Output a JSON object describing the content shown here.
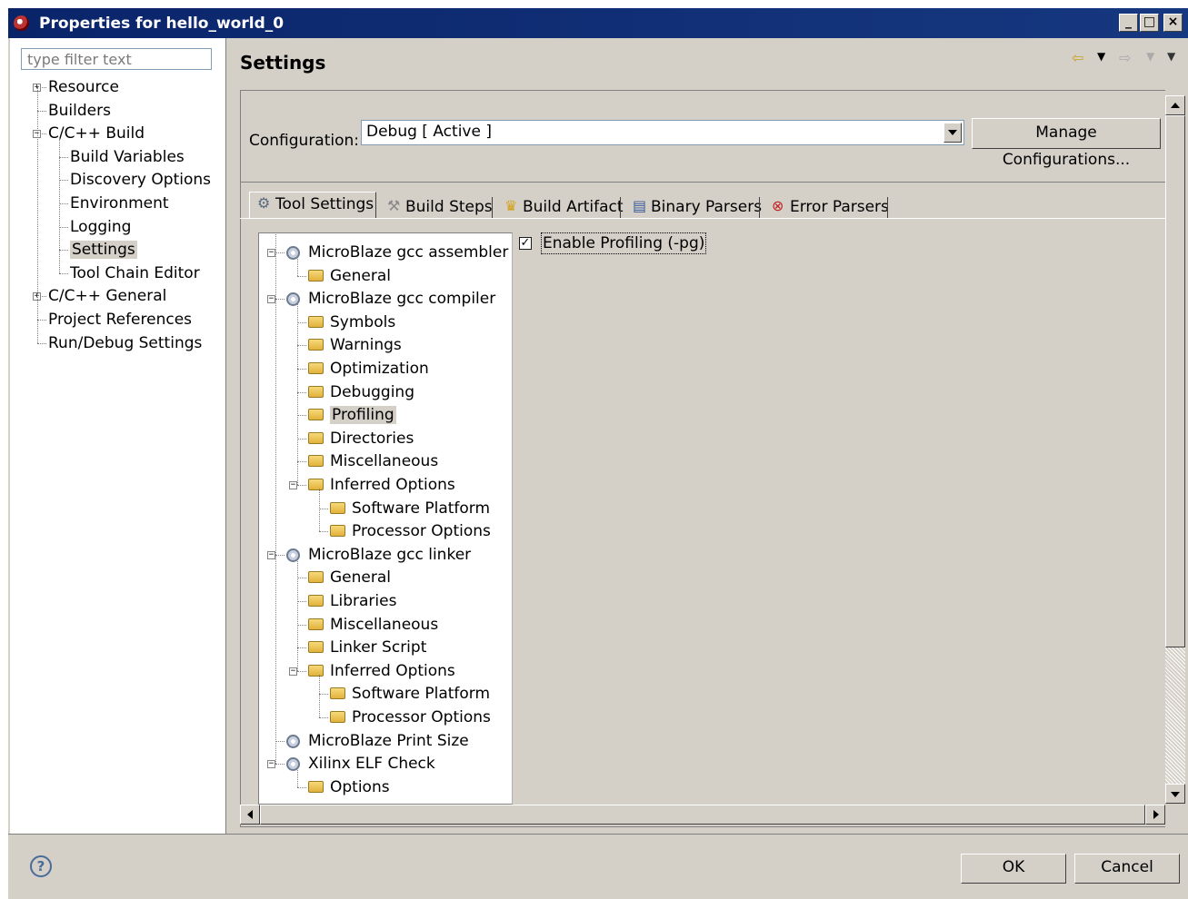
{
  "window": {
    "title": "Properties for hello_world_0",
    "controls": {
      "minimize": "_",
      "maximize": "□",
      "close": "×"
    }
  },
  "filter": {
    "placeholder": "type filter text"
  },
  "nav_tree": [
    {
      "label": "Resource",
      "level": 0,
      "toggle": "+"
    },
    {
      "label": "Builders",
      "level": 0
    },
    {
      "label": "C/C++ Build",
      "level": 0,
      "toggle": "−"
    },
    {
      "label": "Build Variables",
      "level": 1
    },
    {
      "label": "Discovery Options",
      "level": 1
    },
    {
      "label": "Environment",
      "level": 1
    },
    {
      "label": "Logging",
      "level": 1
    },
    {
      "label": "Settings",
      "level": 1,
      "selected": true
    },
    {
      "label": "Tool Chain Editor",
      "level": 1
    },
    {
      "label": "C/C++ General",
      "level": 0,
      "toggle": "+"
    },
    {
      "label": "Project References",
      "level": 0
    },
    {
      "label": "Run/Debug Settings",
      "level": 0
    }
  ],
  "page": {
    "title": "Settings"
  },
  "configuration": {
    "label": "Configuration:",
    "value": "Debug  [ Active ]",
    "manage_button": "Manage Configurations..."
  },
  "tabs": [
    {
      "label": "Tool Settings",
      "icon": "gear-icon",
      "active": true
    },
    {
      "label": "Build Steps",
      "icon": "hammer-icon"
    },
    {
      "label": "Build Artifact",
      "icon": "trophy-icon"
    },
    {
      "label": "Binary Parsers",
      "icon": "binary-icon"
    },
    {
      "label": "Error Parsers",
      "icon": "error-icon"
    }
  ],
  "tool_tree": [
    {
      "label": "MicroBlaze gcc assembler",
      "level": 0,
      "icon": "tool",
      "toggle": "−"
    },
    {
      "label": "General",
      "level": 1,
      "icon": "folder"
    },
    {
      "label": "MicroBlaze gcc compiler",
      "level": 0,
      "icon": "tool",
      "toggle": "−"
    },
    {
      "label": "Symbols",
      "level": 1,
      "icon": "folder"
    },
    {
      "label": "Warnings",
      "level": 1,
      "icon": "folder"
    },
    {
      "label": "Optimization",
      "level": 1,
      "icon": "folder"
    },
    {
      "label": "Debugging",
      "level": 1,
      "icon": "folder"
    },
    {
      "label": "Profiling",
      "level": 1,
      "icon": "folder",
      "selected": true
    },
    {
      "label": "Directories",
      "level": 1,
      "icon": "folder"
    },
    {
      "label": "Miscellaneous",
      "level": 1,
      "icon": "folder"
    },
    {
      "label": "Inferred Options",
      "level": 1,
      "icon": "folder",
      "toggle": "−"
    },
    {
      "label": "Software Platform",
      "level": 2,
      "icon": "folder"
    },
    {
      "label": "Processor Options",
      "level": 2,
      "icon": "folder"
    },
    {
      "label": "MicroBlaze gcc linker",
      "level": 0,
      "icon": "tool",
      "toggle": "−"
    },
    {
      "label": "General",
      "level": 1,
      "icon": "folder"
    },
    {
      "label": "Libraries",
      "level": 1,
      "icon": "folder"
    },
    {
      "label": "Miscellaneous",
      "level": 1,
      "icon": "folder"
    },
    {
      "label": "Linker Script",
      "level": 1,
      "icon": "folder"
    },
    {
      "label": "Inferred Options",
      "level": 1,
      "icon": "folder",
      "toggle": "−"
    },
    {
      "label": "Software Platform",
      "level": 2,
      "icon": "folder"
    },
    {
      "label": "Processor Options",
      "level": 2,
      "icon": "folder"
    },
    {
      "label": "MicroBlaze Print Size",
      "level": 0,
      "icon": "tool"
    },
    {
      "label": "Xilinx ELF Check",
      "level": 0,
      "icon": "tool",
      "toggle": "−"
    },
    {
      "label": "Options",
      "level": 1,
      "icon": "folder"
    }
  ],
  "option": {
    "label": "Enable Profiling (-pg)",
    "checked": true,
    "check_mark": "✓"
  },
  "footer": {
    "help": "?",
    "ok": "OK",
    "cancel": "Cancel"
  },
  "colors": {
    "titlebar": "#0a246a",
    "dialog": "#d4d0c8",
    "border": "#808080"
  }
}
